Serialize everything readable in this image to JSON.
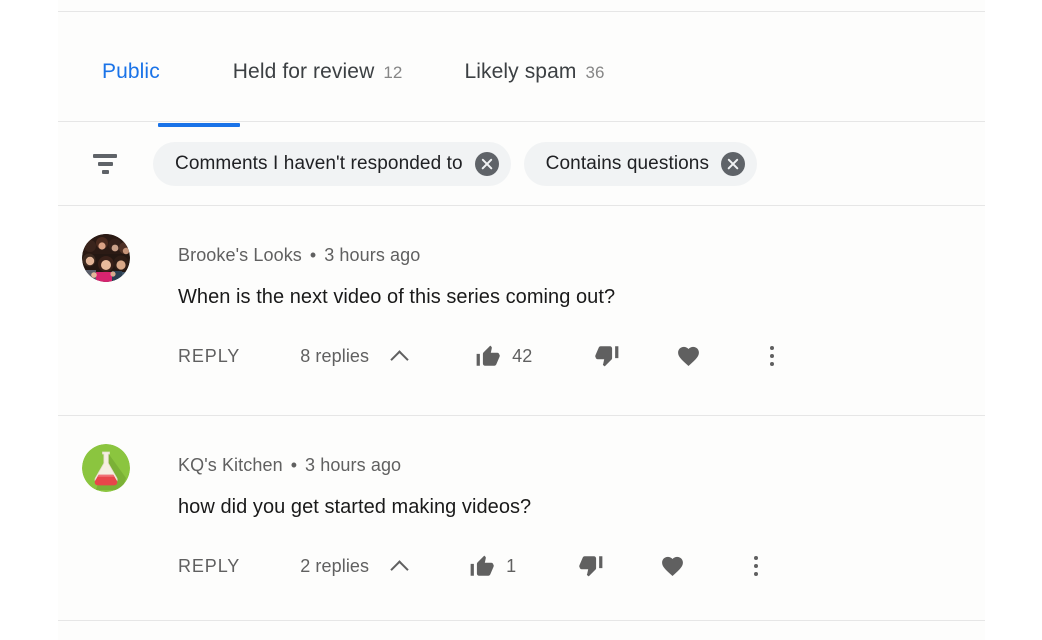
{
  "tabs": [
    {
      "label": "Public",
      "count": "",
      "active": true
    },
    {
      "label": "Held for review",
      "count": "12",
      "active": false
    },
    {
      "label": "Likely spam",
      "count": "36",
      "active": false
    }
  ],
  "filter_bar": {
    "filter_icon": "filter-icon",
    "chips": [
      {
        "label": "Comments I haven't responded to",
        "remove_icon": "close-circle-icon"
      },
      {
        "label": "Contains questions",
        "remove_icon": "close-circle-icon"
      }
    ]
  },
  "comments": [
    {
      "author": "Brooke's Looks",
      "separator": "•",
      "timestamp": "3 hours ago",
      "text": "When is the next video of this series coming out?",
      "avatar_type": "group-photo",
      "actions": {
        "reply_label": "REPLY",
        "replies_label": "8 replies",
        "expand_icon": "chevron-up-icon",
        "like_icon": "thumbs-up-icon",
        "like_count": "42",
        "dislike_icon": "thumbs-down-icon",
        "heart_icon": "heart-icon",
        "more_icon": "more-vertical-icon"
      }
    },
    {
      "author": "KQ's Kitchen",
      "separator": "•",
      "timestamp": "3 hours ago",
      "text": "how did you get started making videos?",
      "avatar_type": "flask-icon",
      "actions": {
        "reply_label": "REPLY",
        "replies_label": "2 replies",
        "expand_icon": "chevron-up-icon",
        "like_icon": "thumbs-up-icon",
        "like_count": "1",
        "dislike_icon": "thumbs-down-icon",
        "heart_icon": "heart-icon",
        "more_icon": "more-vertical-icon"
      }
    }
  ],
  "colors": {
    "accent": "#1a73e8",
    "text_primary": "#1a1a1a",
    "text_secondary": "#606060",
    "chip_bg": "#f1f3f4",
    "divider": "#e6e6e6",
    "avatar_green": "#8bc53f",
    "flask_liquid": "#e8464a"
  }
}
